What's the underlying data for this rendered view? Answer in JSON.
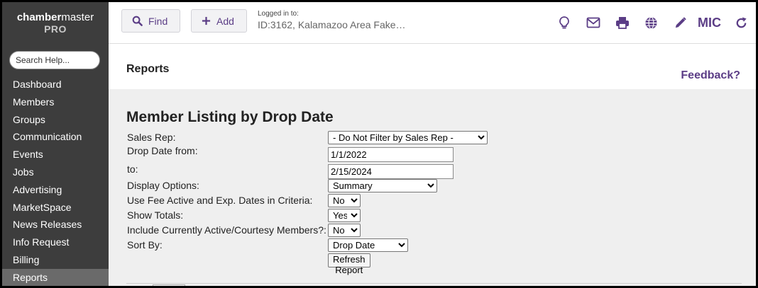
{
  "sidebar": {
    "logo_bold": "chamber",
    "logo_rest": "master",
    "logo_pro": "PRO",
    "search_placeholder": "Search Help...",
    "items": [
      {
        "label": "Dashboard"
      },
      {
        "label": "Members"
      },
      {
        "label": "Groups"
      },
      {
        "label": "Communication"
      },
      {
        "label": "Events"
      },
      {
        "label": "Jobs"
      },
      {
        "label": "Advertising"
      },
      {
        "label": "MarketSpace"
      },
      {
        "label": "News Releases"
      },
      {
        "label": "Info Request"
      },
      {
        "label": "Billing"
      },
      {
        "label": "Reports",
        "active": true
      }
    ]
  },
  "topbar": {
    "find_label": "Find",
    "add_label": "Add",
    "logged_in_label": "Logged in to:",
    "logged_in_value": "ID:3162, Kalamazoo Area Fake…",
    "icons": [
      "lightbulb-icon",
      "mail-icon",
      "print-icon",
      "globe-icon",
      "pencil-icon",
      "refresh-icon"
    ],
    "user_initials": "MIC",
    "accent_color": "#5b3d86"
  },
  "header": {
    "title": "Reports",
    "feedback": "Feedback?"
  },
  "report": {
    "title": "Member Listing by Drop Date",
    "sales_rep_label": "Sales Rep:",
    "sales_rep_value": "- Do Not Filter by Sales Rep -",
    "drop_from_label": "Drop Date from:",
    "drop_from_value": "1/1/2022",
    "drop_to_label": "to:",
    "drop_to_value": "2/15/2024",
    "display_label": "Display Options:",
    "display_value": "Summary",
    "fee_label": "Use Fee Active and Exp. Dates in Criteria:",
    "fee_value": "No",
    "totals_label": "Show Totals:",
    "totals_value": "Yes",
    "include_label": "Include Currently Active/Courtesy Members?:",
    "include_value": "No",
    "sort_label": "Sort By:",
    "sort_value": "Drop Date",
    "refresh_label": "Refresh Report"
  }
}
